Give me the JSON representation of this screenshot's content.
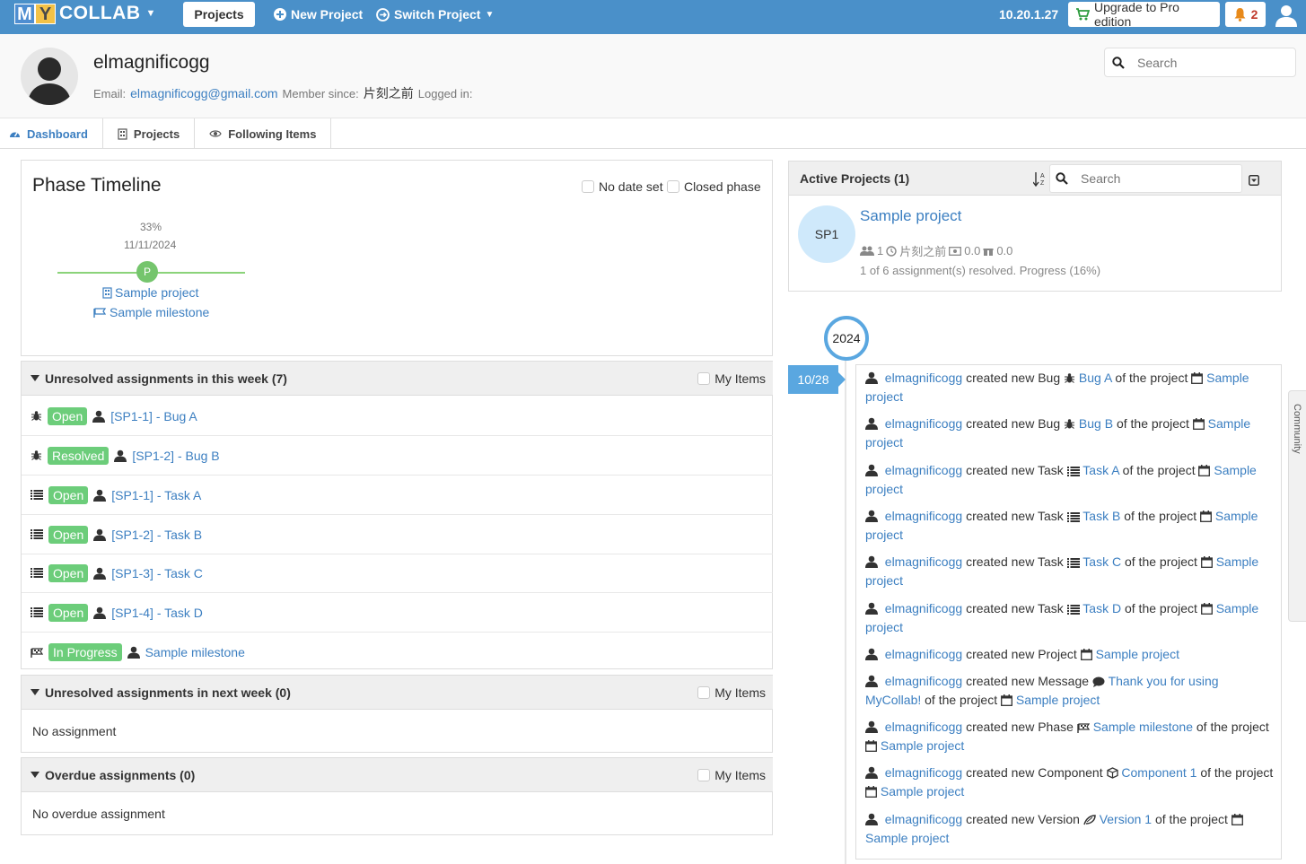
{
  "topbar": {
    "logo_m": "M",
    "logo_y": "Y",
    "logo_rest": "COLLAB",
    "projects_button": "Projects",
    "new_project": "New Project",
    "switch_project": "Switch Project",
    "ip": "10.20.1.27",
    "upgrade": "Upgrade to Pro edition",
    "notif_count": "2"
  },
  "profile": {
    "username": "elmagnificogg",
    "email_label": "Email:",
    "email": "elmagnificogg@gmail.com",
    "member_since_label": "Member since:",
    "member_since": "片刻之前",
    "logged_in_label": "Logged in:",
    "search_placeholder": "Search"
  },
  "tabs": [
    {
      "label": "Dashboard"
    },
    {
      "label": "Projects"
    },
    {
      "label": "Following Items"
    }
  ],
  "phase": {
    "title": "Phase Timeline",
    "legend_no_date": "No date set",
    "legend_closed": "Closed phase",
    "percent": "33%",
    "date": "11/11/2024",
    "dot_letter": "P",
    "project": "Sample project",
    "milestone": "Sample milestone"
  },
  "this_week": {
    "title": "Unresolved assignments in this week (7)",
    "my_items": "My Items",
    "rows": [
      {
        "type": "bug",
        "status": "Open",
        "name": "[SP1-1] - Bug A"
      },
      {
        "type": "bug",
        "status": "Resolved",
        "name": "[SP1-2] - Bug B"
      },
      {
        "type": "task",
        "status": "Open",
        "name": "[SP1-1] - Task A"
      },
      {
        "type": "task",
        "status": "Open",
        "name": "[SP1-2] - Task B"
      },
      {
        "type": "task",
        "status": "Open",
        "name": "[SP1-3] - Task C"
      },
      {
        "type": "task",
        "status": "Open",
        "name": "[SP1-4] - Task D"
      },
      {
        "type": "milestone",
        "status": "In Progress",
        "name": "Sample milestone"
      }
    ]
  },
  "next_week": {
    "title": "Unresolved assignments in next week (0)",
    "my_items": "My Items",
    "empty": "No assignment"
  },
  "overdue": {
    "title": "Overdue assignments (0)",
    "my_items": "My Items",
    "empty": "No overdue assignment"
  },
  "active_projects": {
    "title": "Active Projects (1)",
    "search_placeholder": "Search",
    "project": {
      "avatar": "SP1",
      "name": "Sample project",
      "members": "1",
      "time": "片刻之前",
      "billable": "0.0",
      "nonbillable": "0.0",
      "progress": "1 of 6 assignment(s) resolved. Progress (16%)"
    }
  },
  "timeline": {
    "year": "2024",
    "date": "10/28",
    "activities": [
      {
        "user": "elmagnificogg",
        "verb": "created new Bug",
        "icon": "bug-icon",
        "item": "Bug A",
        "suffix": "of the project",
        "project": "Sample project"
      },
      {
        "user": "elmagnificogg",
        "verb": "created new Bug",
        "icon": "bug-icon",
        "item": "Bug B",
        "suffix": "of the project",
        "project": "Sample project"
      },
      {
        "user": "elmagnificogg",
        "verb": "created new Task",
        "icon": "task-icon",
        "item": "Task A",
        "suffix": "of the project",
        "project": "Sample project"
      },
      {
        "user": "elmagnificogg",
        "verb": "created new Task",
        "icon": "task-icon",
        "item": "Task B",
        "suffix": "of the project",
        "project": "Sample project"
      },
      {
        "user": "elmagnificogg",
        "verb": "created new Task",
        "icon": "task-icon",
        "item": "Task C",
        "suffix": "of the project",
        "project": "Sample project"
      },
      {
        "user": "elmagnificogg",
        "verb": "created new Task",
        "icon": "task-icon",
        "item": "Task D",
        "suffix": "of the project",
        "project": "Sample project"
      },
      {
        "user": "elmagnificogg",
        "verb": "created new Project",
        "icon": "",
        "item": "",
        "suffix": "",
        "project": "Sample project"
      },
      {
        "user": "elmagnificogg",
        "verb": "created new Message",
        "icon": "message-icon",
        "item": "Thank you for using MyCollab!",
        "suffix": "of the project",
        "project": "Sample project"
      },
      {
        "user": "elmagnificogg",
        "verb": "created new Phase",
        "icon": "milestone-flag-icon",
        "item": "Sample milestone",
        "suffix": "of the project",
        "project": "Sample project"
      },
      {
        "user": "elmagnificogg",
        "verb": "created new Component",
        "icon": "component-icon",
        "item": "Component 1",
        "suffix": "of the project",
        "project": "Sample project"
      },
      {
        "user": "elmagnificogg",
        "verb": "created new Version",
        "icon": "version-icon",
        "item": "Version 1",
        "suffix": "of the project",
        "project": "Sample project"
      }
    ]
  },
  "side_tab": "Community",
  "colors": {
    "topbar": "#4a90c9",
    "link": "#3c7fc1",
    "badge": "#6ccd7a",
    "timeline_accent": "#5aa7e0"
  }
}
